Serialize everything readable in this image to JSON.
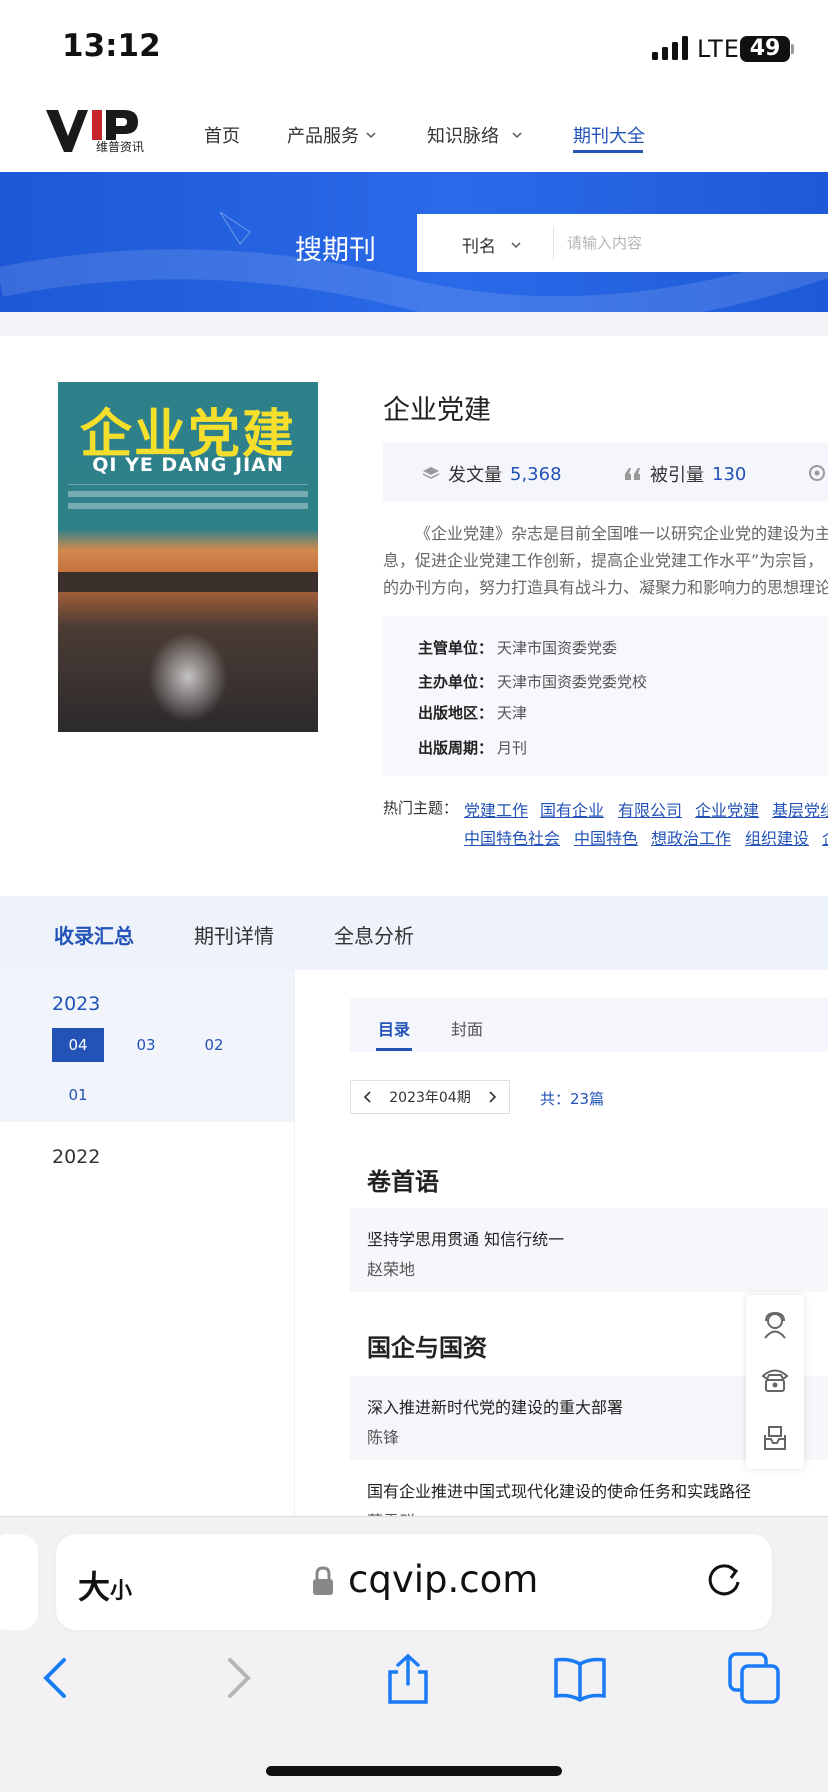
{
  "status": {
    "time": "13:12",
    "network": "LTE",
    "battery": "49"
  },
  "nav": {
    "logo_text": "维普资讯",
    "items": [
      "首页",
      "产品服务",
      "知识脉络",
      "期刊大全"
    ]
  },
  "banner": {
    "title": "搜期刊",
    "search_category": "刊名",
    "search_placeholder": "请输入内容"
  },
  "journal": {
    "cover_title": "企业党建",
    "cover_subtitle": "QI YE DANG JIAN",
    "title": "企业党建",
    "stats": {
      "articles_label": "发文量",
      "articles": "5,368",
      "citations_label": "被引量",
      "citations": "130"
    },
    "description": [
      "《企业党建》杂志是目前全国唯一以研究企业党的建设为主",
      "息，促进企业党建工作创新，提高企业党建工作水平”为宗旨，",
      "的办刊方向，努力打造具有战斗力、凝聚力和影响力的思想理论"
    ],
    "info": [
      {
        "label": "主管单位：",
        "value": "天津市国资委党委"
      },
      {
        "label": "主办单位：",
        "value": "天津市国资委党委党校"
      },
      {
        "label": "出版地区：",
        "value": "天津"
      },
      {
        "label": "出版周期：",
        "value": "月刊"
      }
    ],
    "hot_label": "热门主题：",
    "hot_tags_row1": [
      "党建工作",
      "国有企业",
      "有限公司",
      "企业党建",
      "基层党组"
    ],
    "hot_tags_row2": [
      "中国特色社会",
      "中国特色",
      "想政治工作",
      "组织建设",
      "企"
    ]
  },
  "tabs": [
    "收录汇总",
    "期刊详情",
    "全息分析"
  ],
  "years": [
    {
      "year": "2023",
      "issues": [
        "04",
        "03",
        "02",
        "01"
      ]
    },
    {
      "year": "2022"
    }
  ],
  "content": {
    "subtabs": [
      "目录",
      "封面"
    ],
    "issue_selected": "2023年04期",
    "total": "共：23篇",
    "sections": [
      {
        "heading": "卷首语",
        "articles": [
          {
            "title": "坚持学思用贯通 知信行统一",
            "author": "赵荣地"
          }
        ]
      },
      {
        "heading": "国企与国资",
        "articles": [
          {
            "title": "深入推进新时代党的建设的重大部署",
            "author": "陈锋"
          },
          {
            "title": "国有企业推进中国式现代化建设的使命任务和实践路径",
            "author": "蔡雪群"
          }
        ]
      }
    ]
  },
  "browser": {
    "text_size": "大",
    "text_size_small": "小",
    "url": "cqvip.com"
  },
  "colors": {
    "accent": "#2453b7",
    "banner": "#2a6ae8"
  }
}
